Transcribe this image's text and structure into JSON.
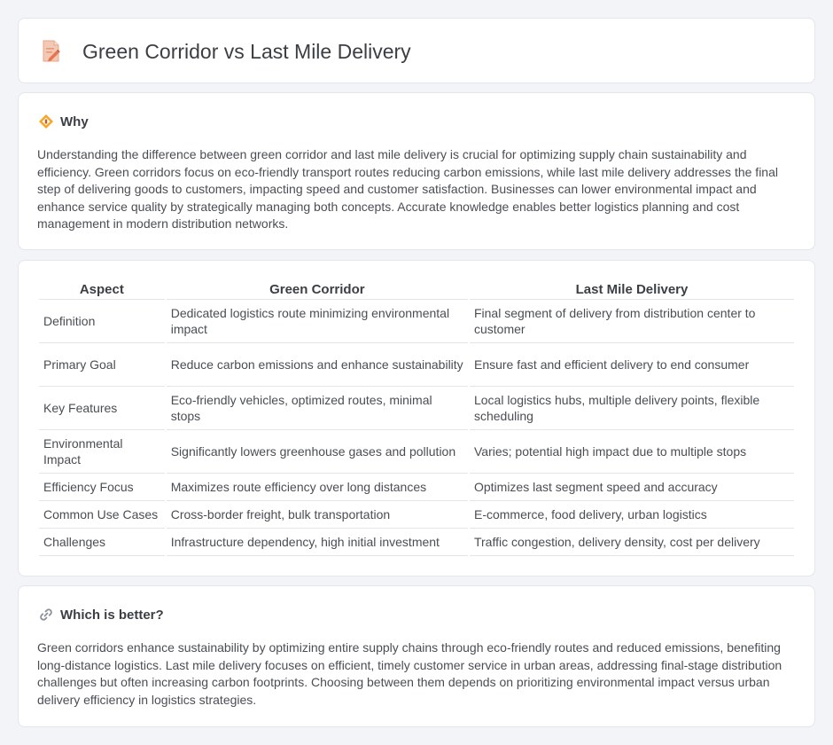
{
  "header": {
    "title": "Green Corridor vs Last Mile Delivery",
    "icon": "document-pencil-icon"
  },
  "why": {
    "heading": "Why",
    "icon": "diamond-sign-icon",
    "text": "Understanding the difference between green corridor and last mile delivery is crucial for optimizing supply chain sustainability and efficiency. Green corridors focus on eco-friendly transport routes reducing carbon emissions, while last mile delivery addresses the final step of delivering goods to customers, impacting speed and customer satisfaction. Businesses can lower environmental impact and enhance service quality by strategically managing both concepts. Accurate knowledge enables better logistics planning and cost management in modern distribution networks."
  },
  "comparison": {
    "headers": [
      "Aspect",
      "Green Corridor",
      "Last Mile Delivery"
    ],
    "rows": [
      [
        "Definition",
        "Dedicated logistics route minimizing environmental impact",
        "Final segment of delivery from distribution center to customer"
      ],
      [
        "Primary Goal",
        "Reduce carbon emissions and enhance sustainability",
        "Ensure fast and efficient delivery to end consumer"
      ],
      [
        "Key Features",
        "Eco-friendly vehicles, optimized routes, minimal stops",
        "Local logistics hubs, multiple delivery points, flexible scheduling"
      ],
      [
        "Environmental Impact",
        "Significantly lowers greenhouse gases and pollution",
        "Varies; potential high impact due to multiple stops"
      ],
      [
        "Efficiency Focus",
        "Maximizes route efficiency over long distances",
        "Optimizes last segment speed and accuracy"
      ],
      [
        "Common Use Cases",
        "Cross-border freight, bulk transportation",
        "E-commerce, food delivery, urban logistics"
      ],
      [
        "Challenges",
        "Infrastructure dependency, high initial investment",
        "Traffic congestion, delivery density, cost per delivery"
      ]
    ]
  },
  "better": {
    "heading": "Which is better?",
    "icon": "link-icon",
    "text": "Green corridors enhance sustainability by optimizing entire supply chains through eco-friendly routes and reduced emissions, benefiting long-distance logistics. Last mile delivery focuses on efficient, timely customer service in urban areas, addressing final-stage distribution challenges but often increasing carbon footprints. Choosing between them depends on prioritizing environmental impact versus urban delivery efficiency in logistics strategies."
  }
}
